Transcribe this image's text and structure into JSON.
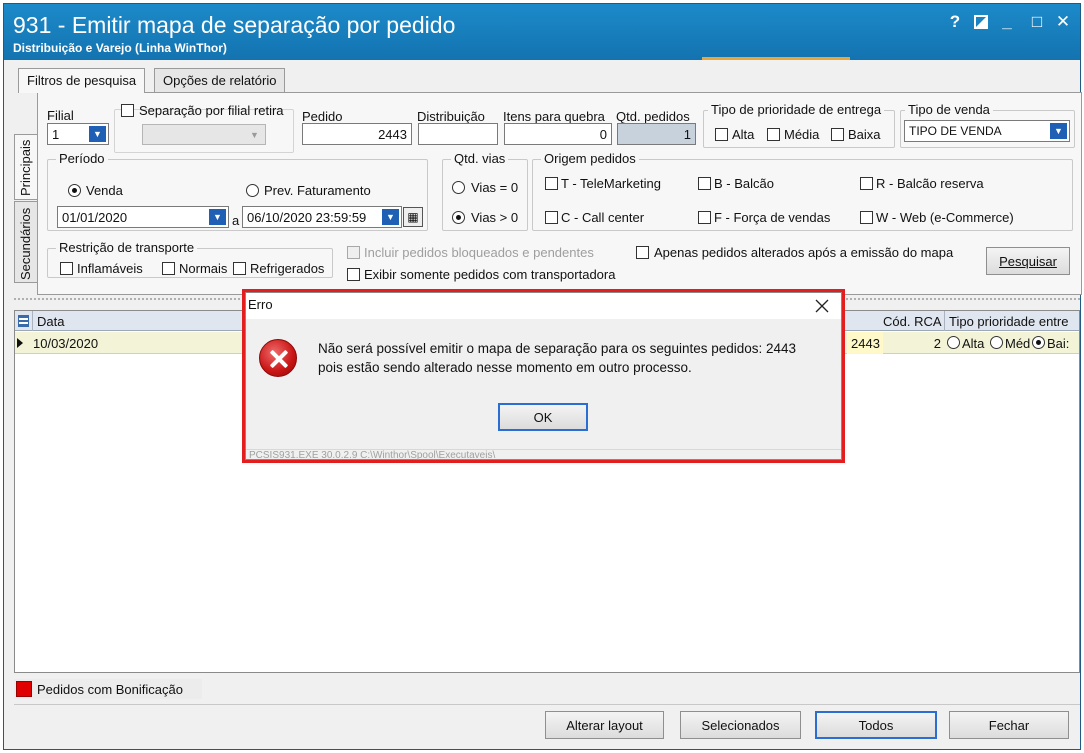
{
  "window": {
    "title": "931 - Emitir mapa de separação por pedido",
    "subtitle": "Distribuição e Varejo (Linha WinThor)",
    "controls": {
      "help": "?",
      "restore_icon": "restore-icon",
      "minimize": "_",
      "maximize": "□",
      "close": "✕"
    }
  },
  "tabs": [
    {
      "label": "Filtros de pesquisa",
      "active": true
    },
    {
      "label": "Opções de relatório",
      "active": false
    }
  ],
  "side_tabs": [
    {
      "label": "Principais",
      "active": true
    },
    {
      "label": "Secundários",
      "active": false
    }
  ],
  "filters": {
    "filial": {
      "label": "Filial",
      "value": "1"
    },
    "separacao_filial_retira": {
      "label": "Separação por filial retira",
      "checked": false,
      "value": ""
    },
    "pedido": {
      "label": "Pedido",
      "value": "2443"
    },
    "distribuicao": {
      "label": "Distribuição",
      "value": ""
    },
    "itens_quebra": {
      "label": "Itens para quebra",
      "value": "0"
    },
    "qtd_pedidos": {
      "label": "Qtd. pedidos",
      "value": "1"
    },
    "tipo_prioridade": {
      "label": "Tipo de prioridade de  entrega",
      "options": [
        {
          "label": "Alta",
          "checked": false
        },
        {
          "label": "Média",
          "checked": false
        },
        {
          "label": "Baixa",
          "checked": false
        }
      ]
    },
    "tipo_venda": {
      "label": "Tipo de venda",
      "value": "TIPO DE VENDA"
    },
    "periodo": {
      "label": "Período",
      "venda_label": "Venda",
      "prev_label": "Prev. Faturamento",
      "selected": "venda",
      "start": "01/01/2020",
      "separator": "a",
      "end": "06/10/2020 23:59:59"
    },
    "qtd_vias": {
      "label": "Qtd. vias",
      "options": [
        {
          "label": "Vias = 0",
          "selected": false
        },
        {
          "label": "Vias > 0",
          "selected": true
        }
      ]
    },
    "origem_pedidos": {
      "label": "Origem pedidos",
      "options": [
        {
          "label": "T - TeleMarketing",
          "checked": false
        },
        {
          "label": "B - Balcão",
          "checked": false
        },
        {
          "label": "R - Balcão reserva",
          "checked": false
        },
        {
          "label": "C - Call center",
          "checked": false
        },
        {
          "label": "F - Força de vendas",
          "checked": false
        },
        {
          "label": "W - Web (e-Commerce)",
          "checked": false
        }
      ]
    },
    "restricao_transporte": {
      "label": "Restrição de transporte",
      "options": [
        {
          "label": "Inflamáveis",
          "checked": false
        },
        {
          "label": "Normais",
          "checked": false
        },
        {
          "label": "Refrigerados",
          "checked": false
        }
      ]
    },
    "incluir_bloqueados": {
      "label": "Incluir pedidos bloqueados e pendentes",
      "checked": false,
      "disabled": true
    },
    "somente_transportadora": {
      "label": "Exibir somente pedidos com transportadora",
      "checked": false
    },
    "apenas_alterados": {
      "label": "Apenas pedidos alterados após a emissão do mapa",
      "checked": false
    },
    "pesquisar_label": "Pesquisar"
  },
  "grid": {
    "columns": [
      "Data",
      "Cód. RCA",
      "Tipo prioridade entre"
    ],
    "rows": [
      {
        "data": "10/03/2020",
        "pedido_partial": "2443",
        "cod_rca": "2",
        "prio_alta": "Alta",
        "prio_media": "Méd",
        "prio_baixa": "Bai:",
        "prio_selected": "baixa"
      }
    ]
  },
  "legend": {
    "label": "Pedidos com Bonificação",
    "color": "#e00000"
  },
  "buttons": {
    "alterar_layout": "Alterar layout",
    "selecionados": "Selecionados",
    "todos": "Todos",
    "fechar": "Fechar"
  },
  "dialog": {
    "title": "Erro",
    "icon": "error-icon",
    "message_line1": "Não será possível emitir o mapa de separação para os seguintes pedidos: 2443",
    "message_line2": "pois estão sendo alterado nesse momento em outro processo.",
    "ok_label": "OK",
    "status": "PCSIS931.EXE 30.0.2.9 C:\\Winthor\\Spool\\Executaveis\\",
    "highlight_color": "#e21e1e"
  }
}
